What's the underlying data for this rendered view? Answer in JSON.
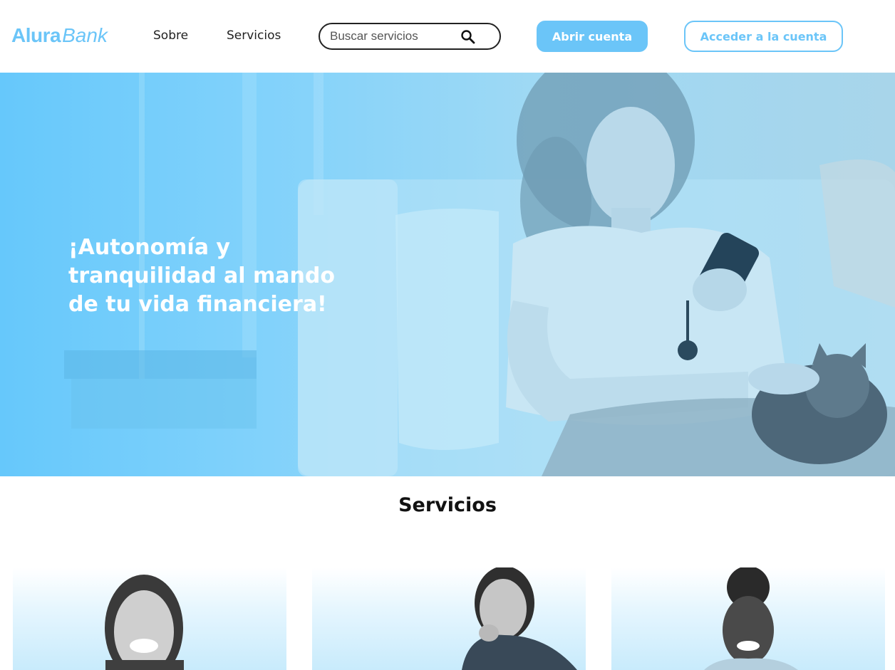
{
  "header": {
    "logo": {
      "part1": "Alura",
      "part2": "Bank"
    },
    "nav": {
      "sobre": "Sobre",
      "servicios": "Servicios"
    },
    "search": {
      "placeholder": "Buscar servicios"
    },
    "buttons": {
      "open_account": "Abrir cuenta",
      "login": "Acceder a la cuenta"
    }
  },
  "hero": {
    "title": "¡Autonomía y tranquilidad al mando de tu vida financiera!"
  },
  "services": {
    "title": "Servicios"
  },
  "colors": {
    "accent": "#6bc5f8",
    "hero_overlay": "#66c8fb",
    "text_dark": "#111111"
  },
  "icons": {
    "search": "search-icon"
  }
}
